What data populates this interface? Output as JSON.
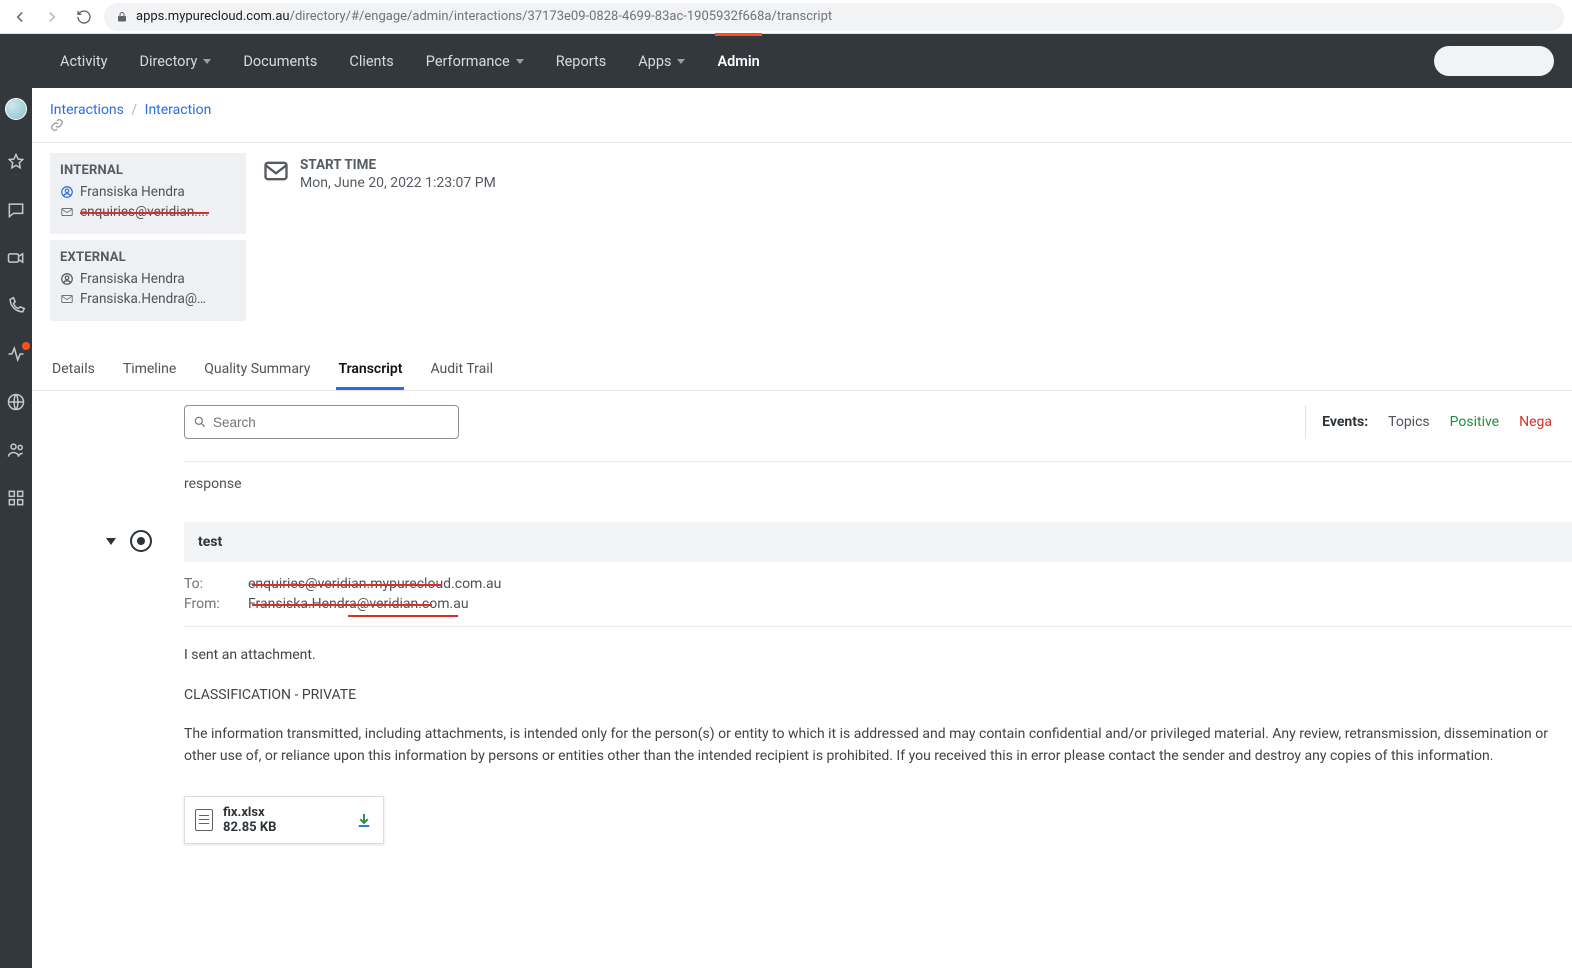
{
  "browser": {
    "url_host": "apps.mypurecloud.com.au",
    "url_path": "/directory/#/engage/admin/interactions/37173e09-0828-4699-83ac-1905932f668a/transcript"
  },
  "nav": {
    "items": [
      {
        "label": "Activity",
        "dropdown": false
      },
      {
        "label": "Directory",
        "dropdown": true
      },
      {
        "label": "Documents",
        "dropdown": false
      },
      {
        "label": "Clients",
        "dropdown": false
      },
      {
        "label": "Performance",
        "dropdown": true
      },
      {
        "label": "Reports",
        "dropdown": false
      },
      {
        "label": "Apps",
        "dropdown": true
      },
      {
        "label": "Admin",
        "dropdown": false,
        "active": true
      }
    ]
  },
  "breadcrumb": {
    "a": "Interactions",
    "b": "Interaction"
  },
  "parties": {
    "internal_label": "INTERNAL",
    "internal_name": "Fransiska Hendra",
    "internal_email": "enquiries@veridian....",
    "external_label": "EXTERNAL",
    "external_name": "Fransiska Hendra",
    "external_email": "Fransiska.Hendra@…"
  },
  "start_time": {
    "label": "START TIME",
    "value": "Mon, June 20, 2022 1:23:07 PM"
  },
  "tabs": {
    "details": "Details",
    "timeline": "Timeline",
    "quality": "Quality Summary",
    "transcript": "Transcript",
    "audit": "Audit Trail"
  },
  "search": {
    "placeholder": "Search"
  },
  "filters": {
    "events": "Events:",
    "topics": "Topics",
    "positive": "Positive",
    "negative": "Nega"
  },
  "transcript": {
    "response": "response",
    "subject": "test",
    "to_label": "To:",
    "to_value": "enquiries@veridian.mypurecloud.com.au",
    "from_label": "From:",
    "from_value": "Fransiska.Hendra@veridian.com.au",
    "body1": "I sent an attachment.",
    "body2": "CLASSIFICATION - PRIVATE",
    "body3": "The information transmitted, including attachments, is intended only for the person(s) or entity to which it is addressed and may contain confidential and/or privileged material. Any review, retransmission, dissemination or other use of, or reliance upon this information by persons or entities other than the intended recipient is prohibited. If you received this in error please contact the sender and destroy any copies of this information."
  },
  "attachment": {
    "name": "fix.xlsx",
    "size": "82.85 KB"
  }
}
